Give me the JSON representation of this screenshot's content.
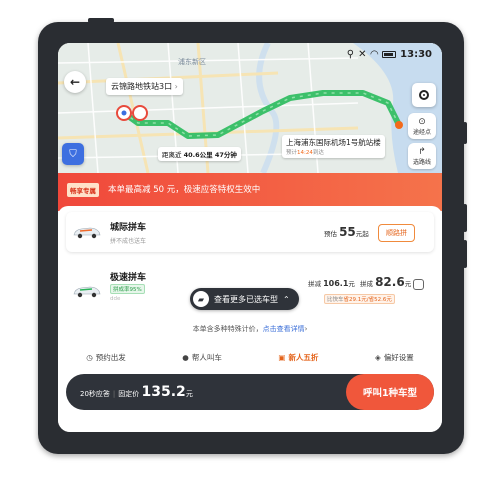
{
  "status_bar": {
    "time": "13:30"
  },
  "map": {
    "district_label": "浦东新区",
    "start_label": "云锦路地铁站3口",
    "start_chevron": "›",
    "distance_prefix": "距离近",
    "distance_value": "40.6公里 47分钟",
    "destination_title": "上海浦东国际机场1号航站楼",
    "destination_sub_prefix": "预计",
    "destination_time": "14:24",
    "destination_sub_suffix": "到达",
    "waypoint_label": "途经点",
    "route_select_label": "选路线",
    "route_color": "#3cc06a"
  },
  "promo": {
    "tag": "畅享专属",
    "text": "本单最高减 50 元，极速应答特权生效中"
  },
  "ride_options": [
    {
      "title": "城际拼车",
      "subtitle": "拼不成也送车",
      "price_prefix": "预估",
      "price": "55",
      "price_suffix": "元起",
      "action_label": "顺路拼"
    },
    {
      "title": "极速拼车",
      "tag": "拼成率95%",
      "extra": "dde",
      "price1_prefix": "拼减",
      "price1": "106.1",
      "price1_suffix": "元",
      "price2_prefix": "拼成",
      "price2": "82.6",
      "price2_suffix": "元",
      "compare_label": "比快车",
      "compare_text": "省29.1元/省52.6元"
    }
  ],
  "more_pill_label": "查看更多已选车型",
  "more_pill_chevron": "⌃",
  "note": {
    "text": "本单含多种特殊计价，",
    "link": "点击查看详情",
    "arrow": "›"
  },
  "options": [
    {
      "label": "预约出发"
    },
    {
      "label": "帮人叫车"
    },
    {
      "label": "新人五折"
    },
    {
      "label": "偏好设置"
    }
  ],
  "bottom": {
    "left_prefix": "20秒应答",
    "left_sep": "|",
    "fixed_label": "固定价",
    "price": "135.2",
    "price_unit": "元",
    "call_label": "呼叫1种车型"
  },
  "colors": {
    "accent": "#f0573b",
    "promo": "#f0483b",
    "dark": "#2f333a"
  }
}
